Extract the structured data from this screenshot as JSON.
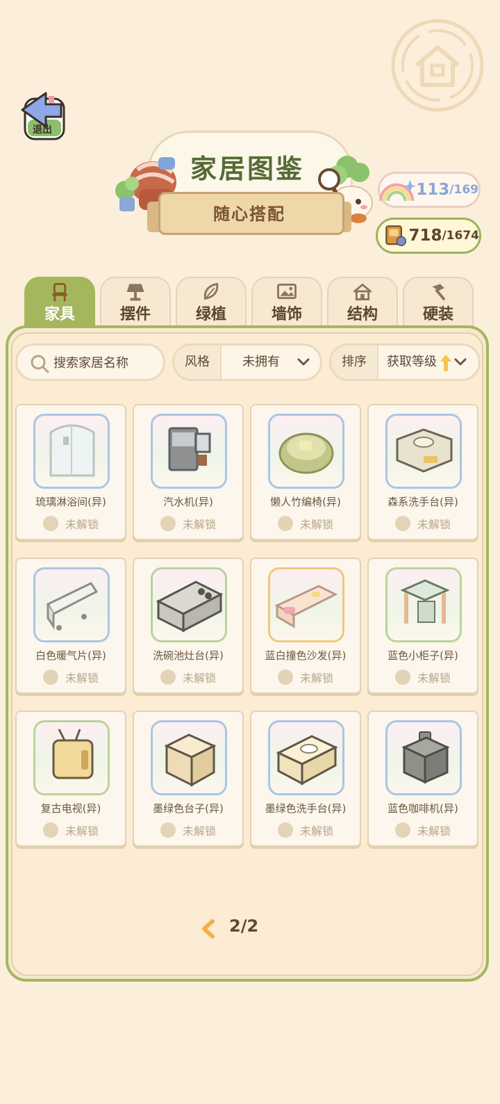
{
  "header": {
    "exit_label": "退出",
    "title": "家居图鉴",
    "subtitle": "随心搭配"
  },
  "counters": {
    "collection": {
      "value": "113",
      "total": "/169",
      "icon": "rainbow-sparkle-icon"
    },
    "points": {
      "value": "718",
      "total": "/1674",
      "icon": "book-badge-icon"
    }
  },
  "tabs": [
    {
      "label": "家具",
      "icon": "chair-icon",
      "active": true
    },
    {
      "label": "摆件",
      "icon": "lamp-icon",
      "active": false
    },
    {
      "label": "绿植",
      "icon": "leaf-icon",
      "active": false
    },
    {
      "label": "墙饰",
      "icon": "picture-frame-icon",
      "active": false
    },
    {
      "label": "结构",
      "icon": "house-icon",
      "active": false
    },
    {
      "label": "硬装",
      "icon": "hammer-icon",
      "active": false
    }
  ],
  "filters": {
    "search_placeholder": "搜索家居名称",
    "style_key": "风格",
    "style_value": "未拥有",
    "sort_key": "排序",
    "sort_value": "获取等级"
  },
  "items": [
    {
      "name": "琉璃淋浴间(异)",
      "status": "未解锁",
      "icon": "shower-cabin-icon"
    },
    {
      "name": "汽水机(异)",
      "status": "未解锁",
      "icon": "soda-machine-icon"
    },
    {
      "name": "懒人竹编椅(异)",
      "status": "未解锁",
      "icon": "bamboo-chair-icon"
    },
    {
      "name": "森系洗手台(异)",
      "status": "未解锁",
      "icon": "wash-basin-icon"
    },
    {
      "name": "白色暖气片(异)",
      "status": "未解锁",
      "icon": "radiator-icon"
    },
    {
      "name": "洗碗池灶台(异)",
      "status": "未解锁",
      "icon": "kitchen-counter-icon"
    },
    {
      "name": "蓝白撞色沙发(异)",
      "status": "未解锁",
      "icon": "sofa-icon"
    },
    {
      "name": "蓝色小柜子(异)",
      "status": "未解锁",
      "icon": "small-cabinet-icon"
    },
    {
      "name": "复古电视(异)",
      "status": "未解锁",
      "icon": "retro-tv-icon"
    },
    {
      "name": "墨绿色台子(异)",
      "status": "未解锁",
      "icon": "counter-block-icon"
    },
    {
      "name": "墨绿色洗手台(异)",
      "status": "未解锁",
      "icon": "vanity-sink-icon"
    },
    {
      "name": "蓝色咖啡机(异)",
      "status": "未解锁",
      "icon": "coffee-machine-icon"
    }
  ],
  "pager": {
    "text": "2/2"
  },
  "colors": {
    "accent": "#a5b75d",
    "background": "#fbeedb",
    "text": "#5e4a36"
  }
}
